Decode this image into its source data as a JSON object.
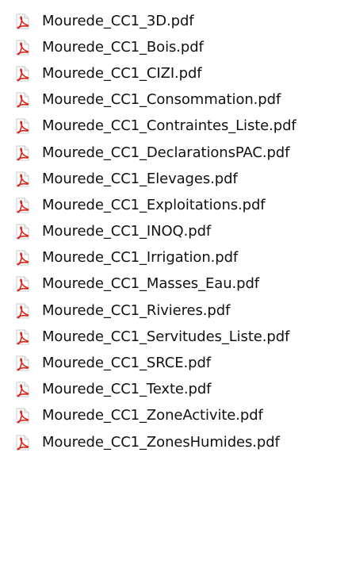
{
  "file_list": {
    "icon": "pdf-file-icon",
    "icon_color": "#d9261c",
    "items": [
      {
        "name": "Mourede_CC1_3D.pdf"
      },
      {
        "name": "Mourede_CC1_Bois.pdf"
      },
      {
        "name": "Mourede_CC1_CIZI.pdf"
      },
      {
        "name": "Mourede_CC1_Consommation.pdf"
      },
      {
        "name": "Mourede_CC1_Contraintes_Liste.pdf"
      },
      {
        "name": "Mourede_CC1_DeclarationsPAC.pdf"
      },
      {
        "name": "Mourede_CC1_Elevages.pdf"
      },
      {
        "name": "Mourede_CC1_Exploitations.pdf"
      },
      {
        "name": "Mourede_CC1_INOQ.pdf"
      },
      {
        "name": "Mourede_CC1_Irrigation.pdf"
      },
      {
        "name": "Mourede_CC1_Masses_Eau.pdf"
      },
      {
        "name": "Mourede_CC1_Rivieres.pdf"
      },
      {
        "name": "Mourede_CC1_Servitudes_Liste.pdf"
      },
      {
        "name": "Mourede_CC1_SRCE.pdf"
      },
      {
        "name": "Mourede_CC1_Texte.pdf"
      },
      {
        "name": "Mourede_CC1_ZoneActivite.pdf"
      },
      {
        "name": "Mourede_CC1_ZonesHumides.pdf"
      }
    ]
  }
}
